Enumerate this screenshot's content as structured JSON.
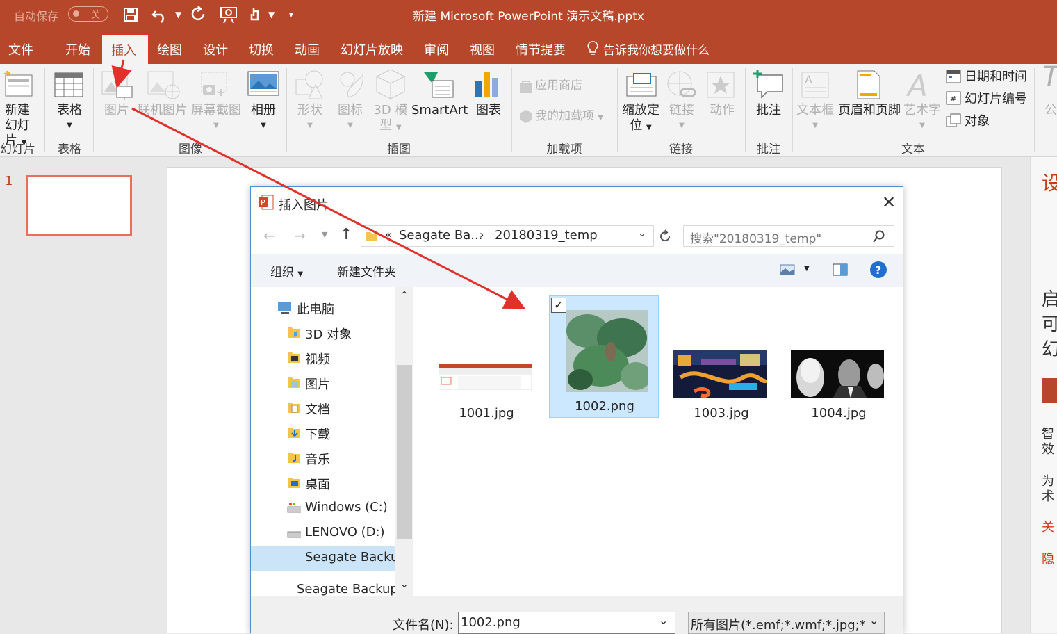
{
  "titlebar": {
    "autosave_label": "自动保存",
    "autosave_state": "关",
    "doc_title": "新建 Microsoft PowerPoint 演示文稿.pptx",
    "accent_color": "#b7472a"
  },
  "tabs": [
    "文件",
    "开始",
    "插入",
    "绘图",
    "设计",
    "切换",
    "动画",
    "幻灯片放映",
    "审阅",
    "视图",
    "情节提要"
  ],
  "tell_me": "告诉我你想要做什么",
  "ribbon": {
    "new_slide": [
      "新建",
      "幻灯片"
    ],
    "table": "表格",
    "picture": "图片",
    "online_picture": "联机图片",
    "screenshot": "屏幕截图",
    "album": "相册",
    "shapes": "形状",
    "icons": "图标",
    "model3d": [
      "3D 模",
      "型"
    ],
    "smartart": "SmartArt",
    "chart": "图表",
    "store": "应用商店",
    "my_addins": "我的加载项",
    "zoom": [
      "缩放定",
      "位"
    ],
    "link": "链接",
    "action": "动作",
    "comment": "批注",
    "textbox": "文本框",
    "header_footer": "页眉和页脚",
    "wordart": "艺术字",
    "datetime": "日期和时间",
    "slide_number": "幻灯片编号",
    "object": "对象",
    "groups": {
      "slides": "幻灯片",
      "tables": "表格",
      "images": "图像",
      "illustrations": "插图",
      "addins": "加载项",
      "links": "链接",
      "comments": "批注",
      "text": "文本"
    }
  },
  "slide_pane": {
    "number": "1"
  },
  "right_pane": {
    "chars": [
      "设",
      "启",
      "可",
      "幻",
      "智",
      "效",
      "为",
      "术",
      "关",
      "隐"
    ]
  },
  "dialog": {
    "title": "插入图片",
    "path": [
      "Seagate Ba...",
      "20180319_temp"
    ],
    "path_prefix": "«",
    "search_placeholder": "搜索\"20180319_temp\"",
    "organize": "组织",
    "new_folder": "新建文件夹",
    "nav": [
      "此电脑",
      "3D 对象",
      "视频",
      "图片",
      "文档",
      "下载",
      "音乐",
      "桌面",
      "Windows (C:)",
      "LENOVO (D:)",
      "Seagate Backup",
      "Seagate Backup"
    ],
    "files": [
      "1001.jpg",
      "1002.png",
      "1003.jpg",
      "1004.jpg"
    ],
    "selected_file": "1002.png",
    "filename_label": "文件名(N):",
    "filename_value": "1002.png",
    "filetype": "所有图片(*.emf;*.wmf;*.jpg;*.jpeg"
  }
}
